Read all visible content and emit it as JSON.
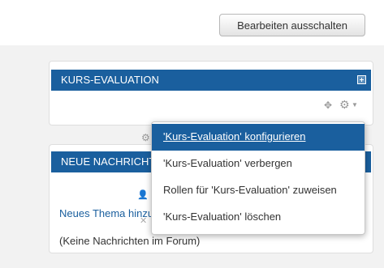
{
  "toolbar": {
    "edit_toggle_label": "Bearbeiten ausschalten"
  },
  "blocks": {
    "course_eval": {
      "title": "KURS-EVALUATION"
    },
    "news": {
      "title": "NEUE NACHRICHTEN",
      "add_topic": "Neues Thema hinzufügen...",
      "empty": "(Keine Nachrichten im Forum)"
    }
  },
  "context_menu": {
    "items": [
      "'Kurs-Evaluation' konfigurieren",
      "'Kurs-Evaluation' verbergen",
      "Rollen für 'Kurs-Evaluation' zuweisen",
      "'Kurs-Evaluation' löschen"
    ]
  },
  "icons": [
    "collapse-icon",
    "move-icon",
    "gear-icon",
    "chevron-down-icon",
    "user-icon",
    "close-icon"
  ],
  "colors": {
    "header_blue": "#1a5f9e",
    "highlight": "#1a5f9e"
  }
}
